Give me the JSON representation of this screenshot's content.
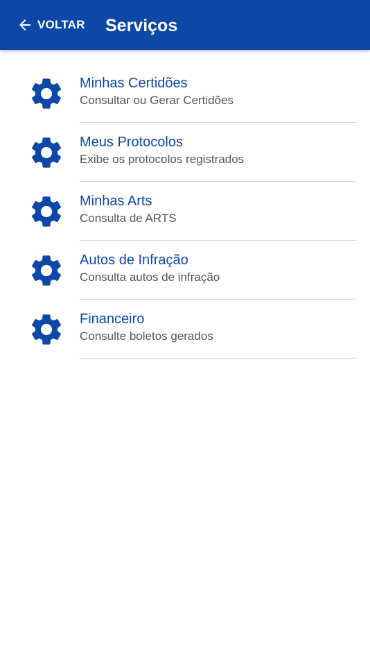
{
  "header": {
    "back_label": "VOLTAR",
    "title": "Serviços",
    "back_icon": "arrow-left-icon"
  },
  "colors": {
    "primary": "#0d47a8",
    "subtitle": "#555555",
    "divider": "#d6d6d6",
    "background": "#ffffff"
  },
  "services": [
    {
      "title": "Minhas Certidões",
      "subtitle": "Consultar ou Gerar Certidões",
      "icon": "gear-icon"
    },
    {
      "title": "Meus Protocolos",
      "subtitle": "Exibe os protocolos registrados",
      "icon": "gear-icon"
    },
    {
      "title": "Minhas Arts",
      "subtitle": "Consulta de ARTS",
      "icon": "gear-icon"
    },
    {
      "title": "Autos de Infração",
      "subtitle": "Consulta autos de infração",
      "icon": "gear-icon"
    },
    {
      "title": "Financeiro",
      "subtitle": "Consulte boletos gerados",
      "icon": "gear-icon"
    }
  ]
}
